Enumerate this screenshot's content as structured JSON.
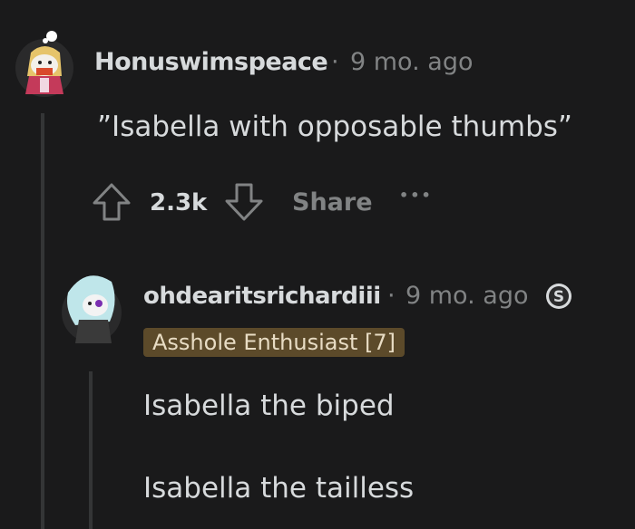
{
  "comment1": {
    "username": "Honuswimspeace",
    "separator": "·",
    "timestamp": "9 mo. ago",
    "body": "”Isabella with opposable thumbs”",
    "score": "2.3k",
    "share_label": "Share",
    "more_label": "•••",
    "icons": {
      "upvote": "upvote-arrow-icon",
      "downvote": "downvote-arrow-icon",
      "more": "more-options-icon"
    }
  },
  "comment2": {
    "username": "ohdearitsrichardiii",
    "separator": "·",
    "timestamp": "9 mo. ago",
    "flair": "Asshole Enthusiast [7]",
    "body_lines": [
      "Isabella the biped",
      "Isabella the tailless"
    ],
    "icons": {
      "award": "award-badge-icon"
    }
  },
  "colors": {
    "background": "#1a1a1b",
    "text": "#d7dadc",
    "muted": "#818384",
    "flair_bg": "#5c4a2a",
    "thread_line": "#343536"
  }
}
